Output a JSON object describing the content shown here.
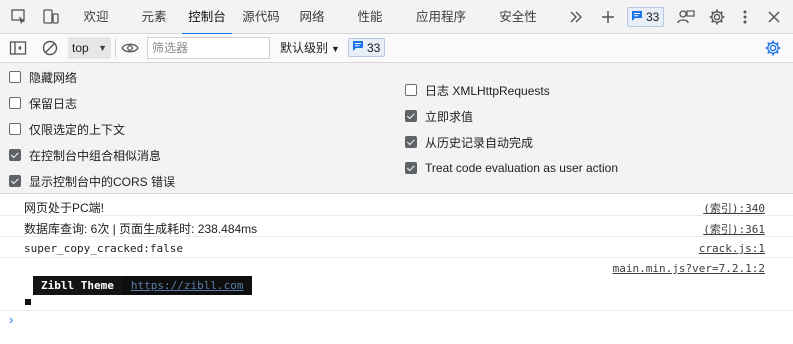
{
  "tabbar": {
    "tabs": [
      {
        "label": "欢迎"
      },
      {
        "label": "元素"
      },
      {
        "label": "控制台",
        "active": true
      },
      {
        "label": "源代码"
      },
      {
        "label": "网络"
      },
      {
        "label": "性能"
      },
      {
        "label": "应用程序"
      },
      {
        "label": "安全性"
      }
    ],
    "issues_count": "33",
    "icons": [
      "inspect-icon",
      "device-toolbar-icon",
      "more-tabs-icon",
      "add-tab-icon",
      "messages-icon",
      "feedback-icon",
      "settings-icon",
      "kebab-menu-icon",
      "close-icon"
    ]
  },
  "toolbar": {
    "context": "top",
    "filter_placeholder": "筛选器",
    "filter_value": "",
    "level": "默认级别",
    "issues_count": "33"
  },
  "settings": {
    "left": [
      {
        "label": "隐藏网络",
        "checked": false
      },
      {
        "label": "保留日志",
        "checked": false
      },
      {
        "label": "仅限选定的上下文",
        "checked": false
      },
      {
        "label": "在控制台中组合相似消息",
        "checked": true
      },
      {
        "label": "显示控制台中的CORS 错误",
        "checked": true
      }
    ],
    "right": [
      {
        "label": "日志 XMLHttpRequests",
        "checked": false
      },
      {
        "label": "立即求值",
        "checked": true
      },
      {
        "label": "从历史记录自动完成",
        "checked": true
      },
      {
        "label": "Treat code evaluation as user action",
        "checked": true
      }
    ]
  },
  "console": {
    "messages": [
      {
        "text": "网页处于PC端!",
        "source": "(索引):340"
      },
      {
        "text": "数据库查询: 6次 | 页面生成耗时: 238.484ms",
        "source": "(索引):361"
      },
      {
        "text": "super_copy_cracked:false",
        "source": "crack.js:1"
      },
      {
        "text": "",
        "source": "main.min.js?ver=7.2.1:2"
      }
    ],
    "banner": {
      "name": "Zibll Theme",
      "url": "https://zibll.com"
    }
  },
  "colors": {
    "accent": "#1a73e8",
    "badge_bg": "#e8eef8"
  }
}
